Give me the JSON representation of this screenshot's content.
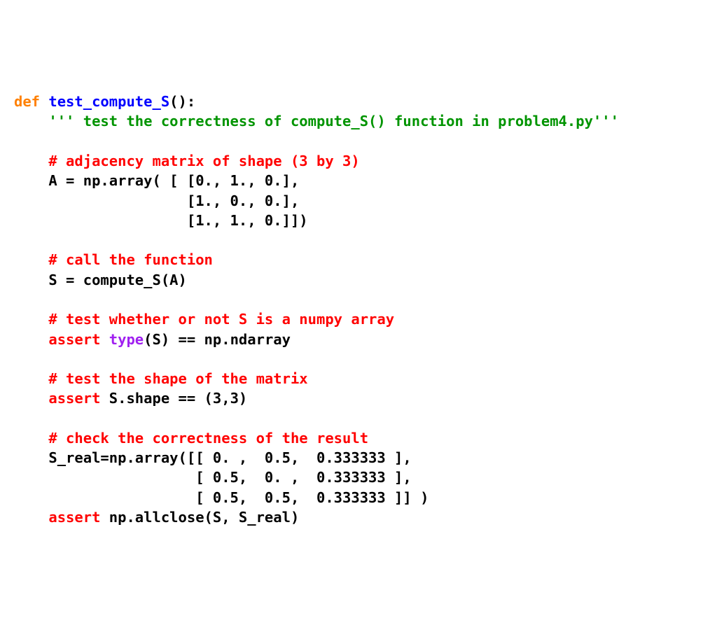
{
  "lines": {
    "def_kw": "def",
    "fn": "test_compute_S",
    "def_tail": "():",
    "docstring": "''' test the correctness of compute_S() function in problem4.py'''",
    "c_adj": "# adjacency matrix of shape (3 by 3)",
    "arr1": "A = np.array( [ [0., 1., 0.],",
    "arr2": "                [1., 0., 0.],",
    "arr3": "                [1., 1., 0.]])",
    "c_call": "# call the function",
    "call": "S = compute_S(A)",
    "c_numpy": "# test whether or not S is a numpy array",
    "assert_kw": "assert",
    "space": " ",
    "type_kw": "type",
    "type_tail": "(S) == np.ndarray",
    "c_shape": "# test the shape of the matrix",
    "shape_tail": " S.shape == (3,3)",
    "c_result": "# check the correctness of the result",
    "sr1": "S_real=np.array([[ 0. ,  0.5,  0.333333 ],",
    "sr2": "                 [ 0.5,  0. ,  0.333333 ],",
    "sr3": "                 [ 0.5,  0.5,  0.333333 ]] )",
    "allclose_tail": " np.allclose(S, S_real)"
  },
  "indent": "    "
}
